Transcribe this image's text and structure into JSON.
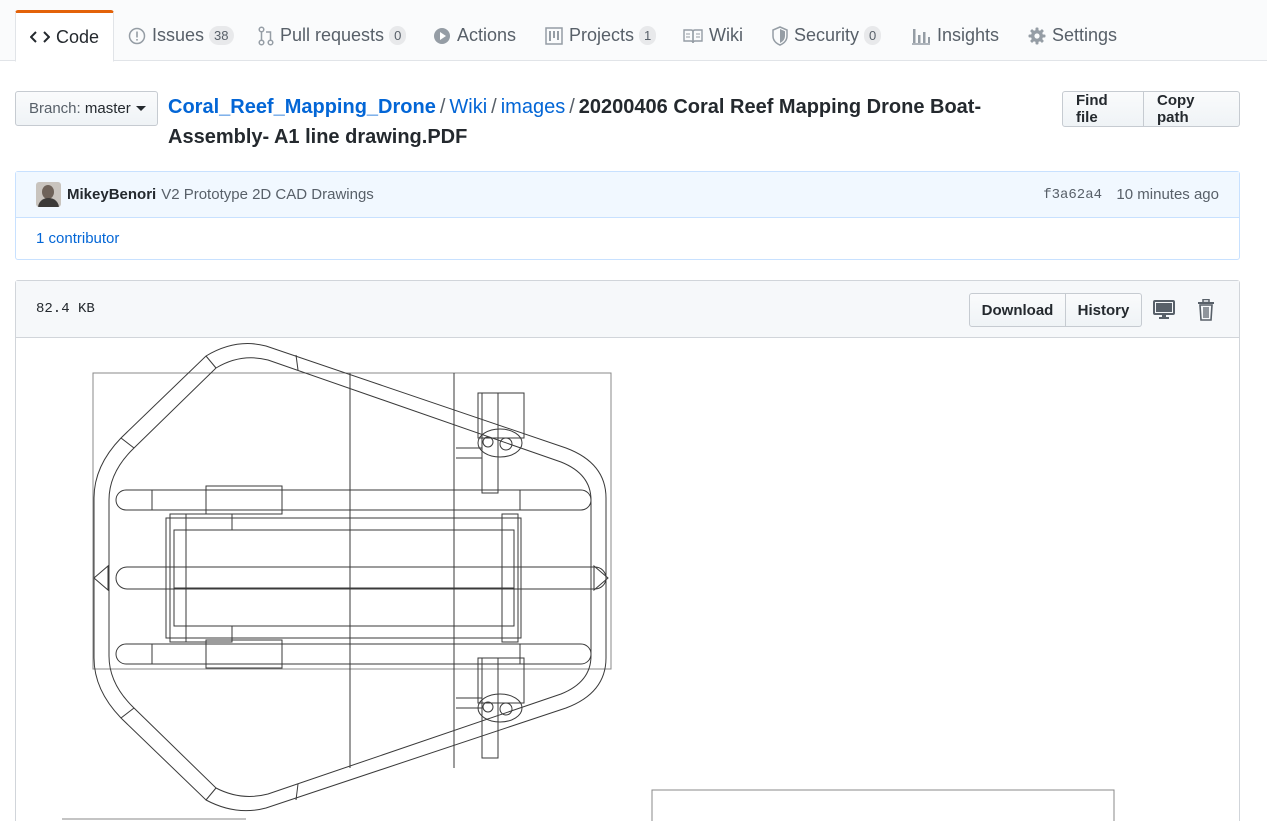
{
  "tabs": [
    {
      "label": "Code",
      "icon": "code-icon",
      "selected": true
    },
    {
      "label": "Issues",
      "icon": "issue-icon",
      "count": "38"
    },
    {
      "label": "Pull requests",
      "icon": "pull-request-icon",
      "count": "0"
    },
    {
      "label": "Actions",
      "icon": "play-icon"
    },
    {
      "label": "Projects",
      "icon": "project-icon",
      "count": "1"
    },
    {
      "label": "Wiki",
      "icon": "book-icon"
    },
    {
      "label": "Security",
      "icon": "shield-icon",
      "count": "0"
    },
    {
      "label": "Insights",
      "icon": "graph-icon"
    },
    {
      "label": "Settings",
      "icon": "gear-icon"
    }
  ],
  "branch": {
    "prefix": "Branch:",
    "name": "master"
  },
  "breadcrumb": {
    "repo": "Coral_Reef_Mapping_Drone",
    "sep": "/",
    "dirs": [
      "Wiki",
      "images"
    ],
    "file": "20200406 Coral Reef Mapping Drone Boat-Assembly- A1 line drawing.PDF"
  },
  "actions": {
    "find_file": "Find file",
    "copy_path": "Copy path"
  },
  "commit": {
    "author": "MikeyBenori",
    "message": "V2 Prototype 2D CAD Drawings",
    "sha": "f3a62a4",
    "time": "10 minutes ago"
  },
  "contributors": "1 contributor",
  "file": {
    "size": "82.4 KB",
    "download": "Download",
    "history": "History",
    "icons": [
      "desktop-icon",
      "trashcan-icon"
    ]
  },
  "colors": {
    "accent": "#e36209",
    "link": "#0366d6",
    "tease_bg": "#f1f8ff"
  }
}
